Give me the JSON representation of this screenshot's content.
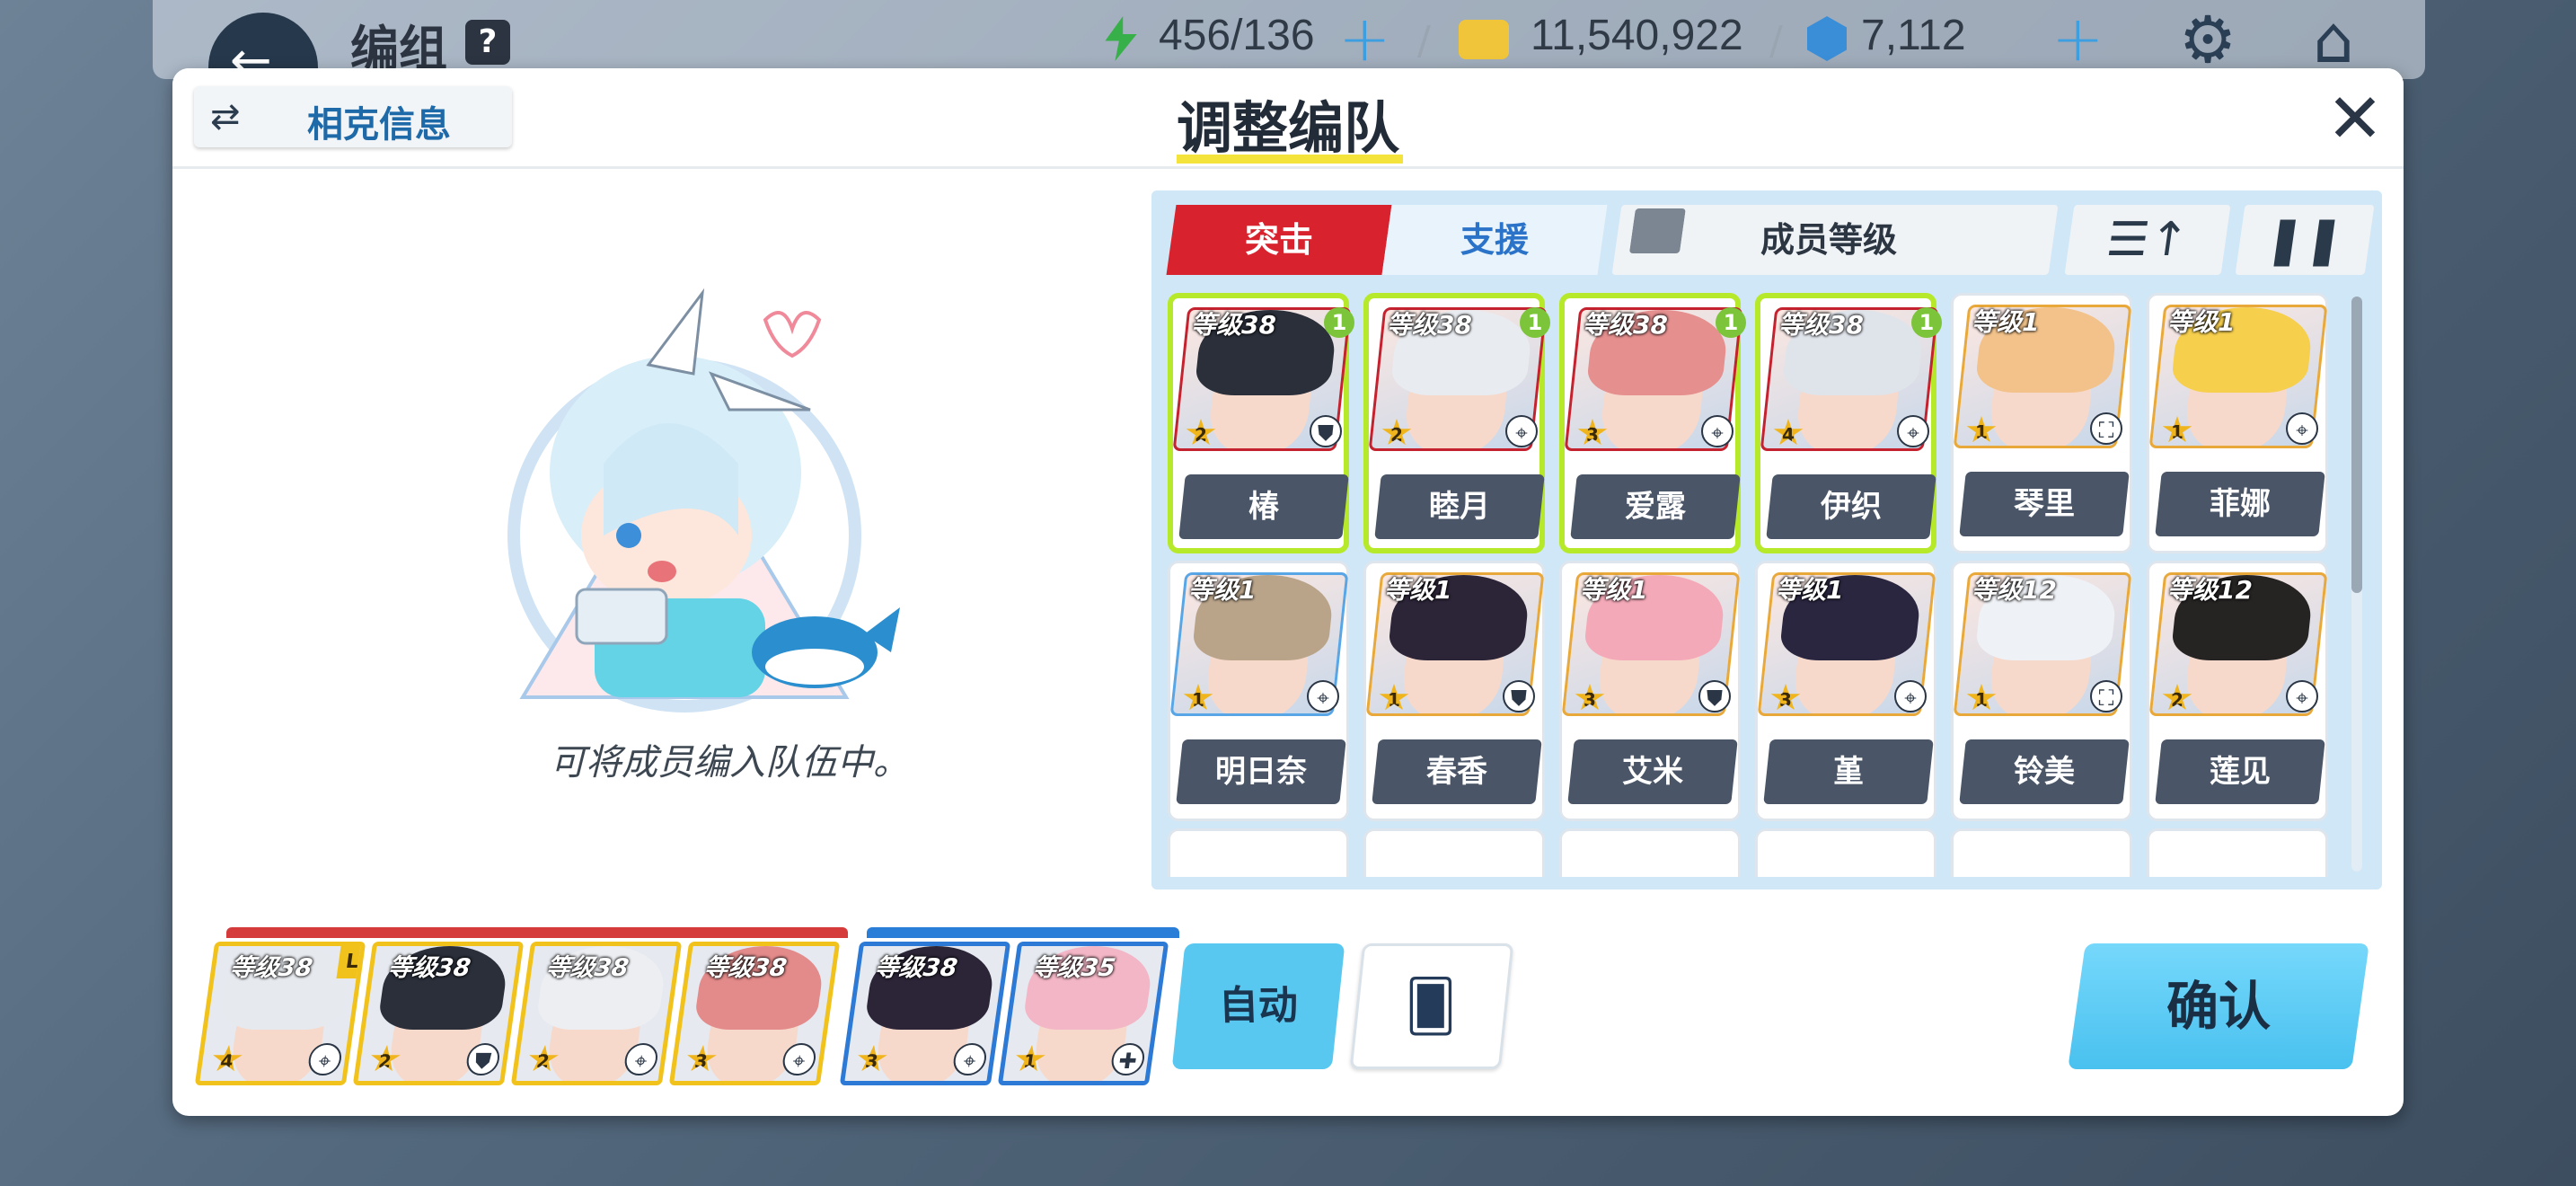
{
  "topbar": {
    "title": "编组",
    "help": "?",
    "stamina": "456/136",
    "credits": "11,540,922",
    "gems": "7,112"
  },
  "dialog": {
    "title": "调整编队",
    "affinity_label": "相克信息",
    "hint": "可将成员编入队伍中。",
    "tabs": {
      "assault": "突击",
      "support": "支援"
    },
    "filter_label": "成员等级"
  },
  "students": [
    {
      "level": "等级38",
      "name": "椿",
      "stars": "2",
      "new": "1",
      "role": "shield-icon",
      "selected": true
    },
    {
      "level": "等级38",
      "name": "睦月",
      "stars": "2",
      "new": "1",
      "role": "target-icon",
      "selected": true
    },
    {
      "level": "等级38",
      "name": "爱露",
      "stars": "3",
      "new": "1",
      "role": "target-icon",
      "selected": true
    },
    {
      "level": "等级38",
      "name": "伊织",
      "stars": "4",
      "new": "1",
      "role": "target-icon",
      "selected": true
    },
    {
      "level": "等级1",
      "name": "琴里",
      "stars": "1",
      "new": "",
      "role": "support-icon",
      "selected": false
    },
    {
      "level": "等级1",
      "name": "菲娜",
      "stars": "1",
      "new": "",
      "role": "target-icon",
      "selected": false
    },
    {
      "level": "等级1",
      "name": "明日奈",
      "stars": "1",
      "new": "",
      "role": "target-icon",
      "selected": false
    },
    {
      "level": "等级1",
      "name": "春香",
      "stars": "1",
      "new": "",
      "role": "shield-icon",
      "selected": false
    },
    {
      "level": "等级1",
      "name": "艾米",
      "stars": "3",
      "new": "",
      "role": "shield-icon",
      "selected": false
    },
    {
      "level": "等级1",
      "name": "堇",
      "stars": "3",
      "new": "",
      "role": "target-icon",
      "selected": false
    },
    {
      "level": "等级12",
      "name": "铃美",
      "stars": "1",
      "new": "",
      "role": "support-icon",
      "selected": false
    },
    {
      "level": "等级12",
      "name": "莲见",
      "stars": "2",
      "new": "",
      "role": "target-icon",
      "selected": false
    }
  ],
  "team_assault": [
    {
      "level": "等级38",
      "stars": "4",
      "leader": "L"
    },
    {
      "level": "等级38",
      "stars": "2",
      "leader": ""
    },
    {
      "level": "等级38",
      "stars": "2",
      "leader": ""
    },
    {
      "level": "等级38",
      "stars": "3",
      "leader": ""
    }
  ],
  "team_support": [
    {
      "level": "等级38",
      "stars": "3"
    },
    {
      "level": "等级35",
      "stars": "1"
    }
  ],
  "buttons": {
    "auto": "自动",
    "confirm": "确认"
  }
}
